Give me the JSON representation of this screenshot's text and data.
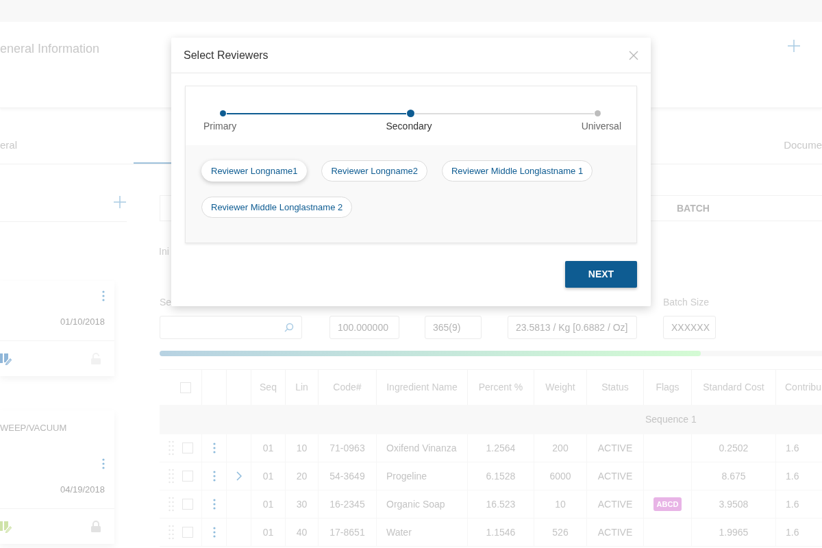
{
  "header": {
    "title": "eneral Information"
  },
  "tabs": [
    {
      "label": "eral",
      "selected": false
    },
    {
      "selected": true
    },
    {
      "label": "Docume",
      "selected": false
    }
  ],
  "cards": [
    {
      "date": "01/10/2018",
      "locked": false,
      "color": "#8fb6d8"
    },
    {
      "title": "WEEP/VACUUM",
      "date": "04/19/2018",
      "locked": true,
      "color": "#cfe3a8"
    }
  ],
  "section_tab": {
    "label": "BATCH"
  },
  "section_label": "Ini",
  "fields": [
    {
      "label": "Se",
      "kind": "search"
    },
    {
      "kind": "text",
      "value": "100.000000"
    },
    {
      "kind": "text",
      "value": "365(9)"
    },
    {
      "kind": "text",
      "value": "23.5813 / Kg [0.6882 / Oz]"
    },
    {
      "label": "Batch Size",
      "kind": "text",
      "value": "XXXXXX"
    }
  ],
  "progress": {
    "level": 0.8
  },
  "table": {
    "columns": [
      "",
      "",
      "",
      "Seq",
      "Lin",
      "Code#",
      "Ingredient Name",
      "Percent %",
      "Weight",
      "Status",
      "Flags",
      "Standard Cost",
      "Contribu"
    ],
    "all_checked": false,
    "group": "Sequence 1",
    "rows": [
      {
        "checked": false,
        "expandable": false,
        "seq": "01",
        "lin": "10",
        "code": "71-0963",
        "name": "Oxifend Vinanza",
        "percent": "1.2564",
        "weight": "200",
        "status": "ACTIVE",
        "cost": "0.2502",
        "contribution": "1.6"
      },
      {
        "checked": false,
        "expandable": true,
        "seq": "01",
        "lin": "20",
        "code": "54-3649",
        "name": "Progeline",
        "percent": "6.1528",
        "weight": "6000",
        "status": "ACTIVE",
        "cost": "8.675",
        "contribution": "1.6"
      },
      {
        "checked": false,
        "expandable": false,
        "seq": "01",
        "lin": "30",
        "code": "16-2345",
        "name": "Organic Soap",
        "percent": "16.523",
        "weight": "10",
        "status": "ACTIVE",
        "flag": {
          "label": "ABCD",
          "color": "#e8b4e6"
        },
        "cost": "3.9508",
        "contribution": "1.6"
      },
      {
        "checked": false,
        "expandable": false,
        "seq": "01",
        "lin": "40",
        "code": "17-8651",
        "name": "Water",
        "percent": "1.1546",
        "weight": "526",
        "status": "ACTIVE",
        "cost": "1.9965",
        "contribution": "1.6"
      }
    ]
  },
  "dialog": {
    "title": "Select Reviewers",
    "steps": [
      {
        "label": "Primary",
        "completed": true,
        "selected": false
      },
      {
        "label": "Secondary",
        "completed": false,
        "selected": true
      },
      {
        "label": "Universal",
        "completed": false,
        "selected": false
      }
    ],
    "reviewers": [
      {
        "name": "Reviewer Longname1",
        "selected": true
      },
      {
        "name": "Reviewer Longname2",
        "selected": false
      },
      {
        "name": "Reviewer Middle Longlastname 1",
        "selected": false
      },
      {
        "name": "Reviewer Middle Longlastname 2",
        "selected": false
      }
    ],
    "button": "NEXT"
  }
}
